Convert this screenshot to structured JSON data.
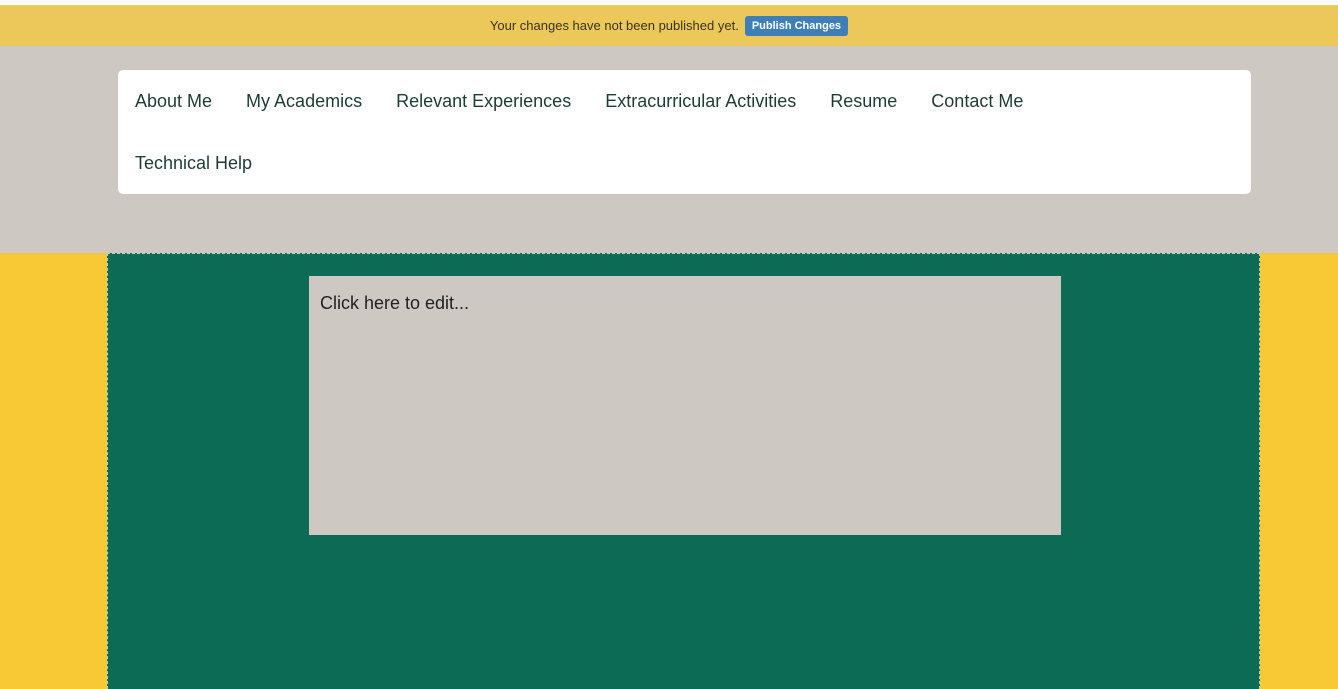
{
  "publish_bar": {
    "message": "Your changes have not been published yet.",
    "button_label": "Publish Changes"
  },
  "nav": {
    "items": [
      {
        "label": "About Me"
      },
      {
        "label": "My Academics"
      },
      {
        "label": "Relevant Experiences"
      },
      {
        "label": "Extracurricular Activities"
      },
      {
        "label": "Resume"
      },
      {
        "label": "Contact Me"
      },
      {
        "label": "Technical Help"
      }
    ]
  },
  "content": {
    "edit_placeholder": "Click here to edit..."
  },
  "colors": {
    "publish_bar_bg": "#ecc85a",
    "publish_button_bg": "#3f7fb8",
    "header_band_bg": "#cdc8c2",
    "main_panel_bg": "#0c6b55",
    "side_bg": "#f8c934"
  }
}
